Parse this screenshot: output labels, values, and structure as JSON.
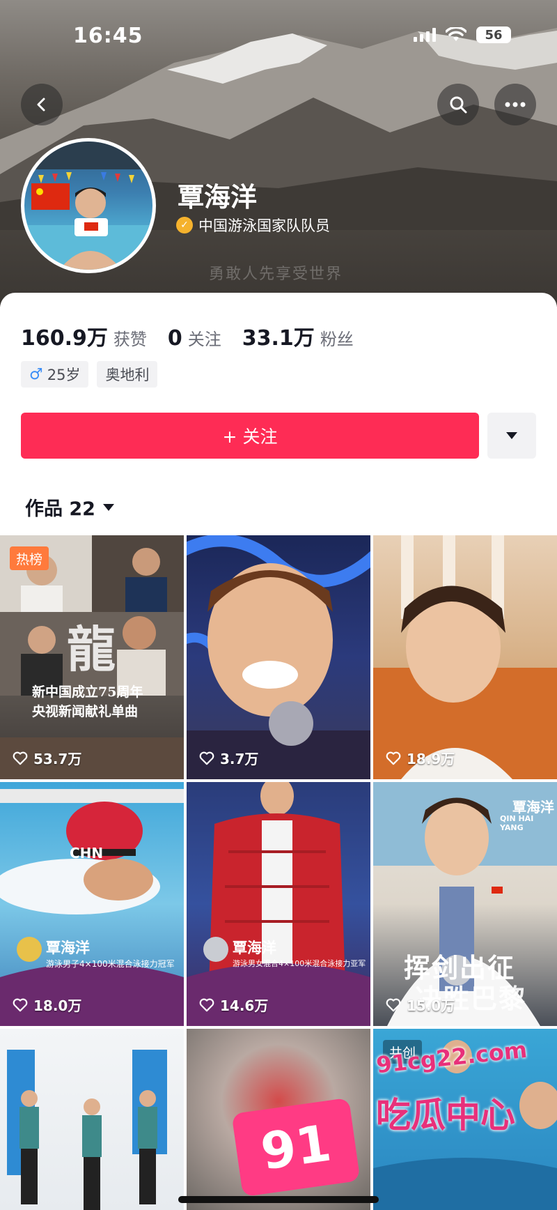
{
  "status_bar": {
    "time": "16:45",
    "battery": "56"
  },
  "header": {
    "name": "覃海洋",
    "verification": "中国游泳国家队队员",
    "faint_caption": "勇敢人先享受世界"
  },
  "stats": [
    {
      "value": "160.9万",
      "label": "获赞"
    },
    {
      "value": "0",
      "label": "关注"
    },
    {
      "value": "33.1万",
      "label": "粉丝"
    }
  ],
  "tags": {
    "gender_symbol": "♂",
    "age": "25岁",
    "location": "奥地利"
  },
  "follow_button": {
    "label": "+ 关注"
  },
  "works_tab": {
    "label": "作品 22"
  },
  "colors": {
    "accent": "#fe2c55",
    "verify": "#f5b22d"
  },
  "videos": [
    {
      "likes": "53.7万",
      "badge": "热榜",
      "line1": "新中国成立75周年",
      "line2": "央视新闻献礼单曲",
      "calligraphy": "龍"
    },
    {
      "likes": "3.7万"
    },
    {
      "likes": "18.9万"
    },
    {
      "likes": "18.0万",
      "overlay_name": "覃海洋",
      "overlay_caption": "游泳男子4×100米混合泳接力冠军",
      "cap_text": "CHN"
    },
    {
      "likes": "14.6万",
      "overlay_name": "覃海洋",
      "overlay_caption": "游泳男女混合4×100米混合泳接力亚军"
    },
    {
      "likes": "15.0万",
      "overlay_name": "覃海洋",
      "overlay_en": "QIN HAI YANG",
      "big_text_1": "挥剑出征",
      "big_text_2": "决胜巴黎"
    },
    {},
    {},
    {
      "badge": "共创"
    }
  ],
  "watermark": {
    "number": "91",
    "site": "91cg22.com",
    "text": "吃瓜中心"
  }
}
